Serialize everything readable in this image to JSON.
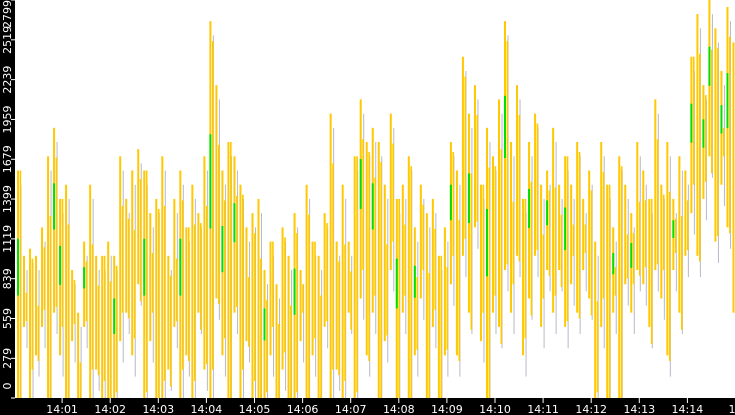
{
  "chart_data": {
    "type": "bar",
    "subtype": "high-low range bars",
    "title": "",
    "xlabel": "",
    "ylabel": "",
    "ylim": [
      0,
      2799
    ],
    "y_ticks": [
      "0",
      "279",
      "559",
      "839",
      "1119",
      "1399",
      "1679",
      "1959",
      "2239",
      "2519",
      "2799"
    ],
    "x_ticks": [
      "14:01",
      "14:02",
      "14:03",
      "14:04",
      "14:05",
      "14:06",
      "14:07",
      "14:08",
      "14:09",
      "14:10",
      "14:11",
      "14:12",
      "14:13",
      "14:14",
      "14"
    ],
    "grid": false,
    "colors": {
      "main": "#ffc800",
      "highlight": "#00e000",
      "thin": "#b8b8c8",
      "axis_bg": "#000000",
      "axis_text": "#ffffff"
    },
    "bars_per_minute": 8,
    "start_time": "14:00",
    "bars": [
      [
        0,
        1600,
        1
      ],
      [
        500,
        1000,
        0
      ],
      [
        0,
        1050,
        0
      ],
      [
        300,
        1000,
        0
      ],
      [
        500,
        1200,
        0
      ],
      [
        0,
        1700,
        0
      ],
      [
        600,
        1900,
        1
      ],
      [
        300,
        1400,
        1
      ],
      [
        0,
        1500,
        0
      ],
      [
        400,
        900,
        0
      ],
      [
        0,
        600,
        0
      ],
      [
        500,
        1100,
        1
      ],
      [
        0,
        1500,
        0
      ],
      [
        200,
        1000,
        0
      ],
      [
        0,
        1000,
        0
      ],
      [
        0,
        1100,
        0
      ],
      [
        0,
        1000,
        1
      ],
      [
        400,
        1700,
        0
      ],
      [
        600,
        1400,
        0
      ],
      [
        300,
        1600,
        0
      ],
      [
        800,
        1750,
        0
      ],
      [
        0,
        1600,
        1
      ],
      [
        400,
        1300,
        0
      ],
      [
        0,
        1400,
        0
      ],
      [
        0,
        1700,
        0
      ],
      [
        200,
        1000,
        0
      ],
      [
        500,
        1400,
        0
      ],
      [
        0,
        1600,
        1
      ],
      [
        300,
        1200,
        0
      ],
      [
        0,
        1500,
        0
      ],
      [
        600,
        1300,
        0
      ],
      [
        200,
        1700,
        0
      ],
      [
        0,
        2650,
        1
      ],
      [
        700,
        2200,
        0
      ],
      [
        300,
        1600,
        1
      ],
      [
        0,
        1800,
        0
      ],
      [
        600,
        1700,
        1
      ],
      [
        0,
        1500,
        0
      ],
      [
        400,
        1200,
        0
      ],
      [
        0,
        1300,
        0
      ],
      [
        0,
        1400,
        0
      ],
      [
        0,
        900,
        1
      ],
      [
        300,
        1100,
        0
      ],
      [
        0,
        800,
        0
      ],
      [
        200,
        1200,
        0
      ],
      [
        0,
        1000,
        0
      ],
      [
        0,
        1300,
        1
      ],
      [
        400,
        900,
        0
      ],
      [
        0,
        1500,
        0
      ],
      [
        300,
        1100,
        0
      ],
      [
        0,
        1000,
        0
      ],
      [
        500,
        1300,
        0
      ],
      [
        0,
        2000,
        0
      ],
      [
        200,
        1100,
        0
      ],
      [
        0,
        1500,
        0
      ],
      [
        600,
        1100,
        0
      ],
      [
        0,
        1700,
        0
      ],
      [
        700,
        2100,
        1
      ],
      [
        300,
        1800,
        0
      ],
      [
        600,
        1900,
        1
      ],
      [
        0,
        1800,
        0
      ],
      [
        400,
        1500,
        0
      ],
      [
        900,
        2000,
        0
      ],
      [
        0,
        1400,
        1
      ],
      [
        600,
        1500,
        0
      ],
      [
        0,
        1700,
        0
      ],
      [
        300,
        1200,
        1
      ],
      [
        700,
        1500,
        0
      ],
      [
        0,
        1300,
        0
      ],
      [
        500,
        1400,
        0
      ],
      [
        0,
        1000,
        0
      ],
      [
        300,
        1200,
        0
      ],
      [
        800,
        1800,
        1
      ],
      [
        300,
        1600,
        0
      ],
      [
        1000,
        2400,
        0
      ],
      [
        600,
        2000,
        1
      ],
      [
        1200,
        2200,
        0
      ],
      [
        400,
        1500,
        0
      ],
      [
        0,
        1900,
        1
      ],
      [
        600,
        1700,
        0
      ],
      [
        500,
        2100,
        0
      ],
      [
        900,
        2650,
        1
      ],
      [
        600,
        1800,
        0
      ],
      [
        1000,
        2200,
        0
      ],
      [
        300,
        1400,
        0
      ],
      [
        700,
        1800,
        1
      ],
      [
        1000,
        2000,
        0
      ],
      [
        500,
        1500,
        0
      ],
      [
        900,
        1600,
        1
      ],
      [
        600,
        1900,
        0
      ],
      [
        900,
        1500,
        0
      ],
      [
        500,
        1700,
        1
      ],
      [
        800,
        1500,
        0
      ],
      [
        600,
        1800,
        0
      ],
      [
        900,
        1400,
        0
      ],
      [
        700,
        1600,
        0
      ],
      [
        0,
        1100,
        0
      ],
      [
        500,
        1800,
        0
      ],
      [
        0,
        1500,
        0
      ],
      [
        600,
        1200,
        1
      ],
      [
        0,
        1700,
        0
      ],
      [
        800,
        1500,
        0
      ],
      [
        600,
        1300,
        1
      ],
      [
        900,
        1800,
        0
      ],
      [
        800,
        1600,
        0
      ],
      [
        500,
        1400,
        0
      ],
      [
        900,
        2100,
        0
      ],
      [
        700,
        1500,
        0
      ],
      [
        300,
        1800,
        0
      ],
      [
        900,
        1400,
        1
      ],
      [
        600,
        1700,
        0
      ],
      [
        1000,
        1600,
        0
      ],
      [
        1300,
        2400,
        1
      ],
      [
        1000,
        2700,
        0
      ],
      [
        1400,
        2200,
        1
      ],
      [
        1700,
        2800,
        1
      ],
      [
        1100,
        2600,
        0
      ],
      [
        1500,
        2300,
        1
      ],
      [
        1200,
        2750,
        1
      ],
      [
        600,
        2500,
        0
      ]
    ]
  }
}
